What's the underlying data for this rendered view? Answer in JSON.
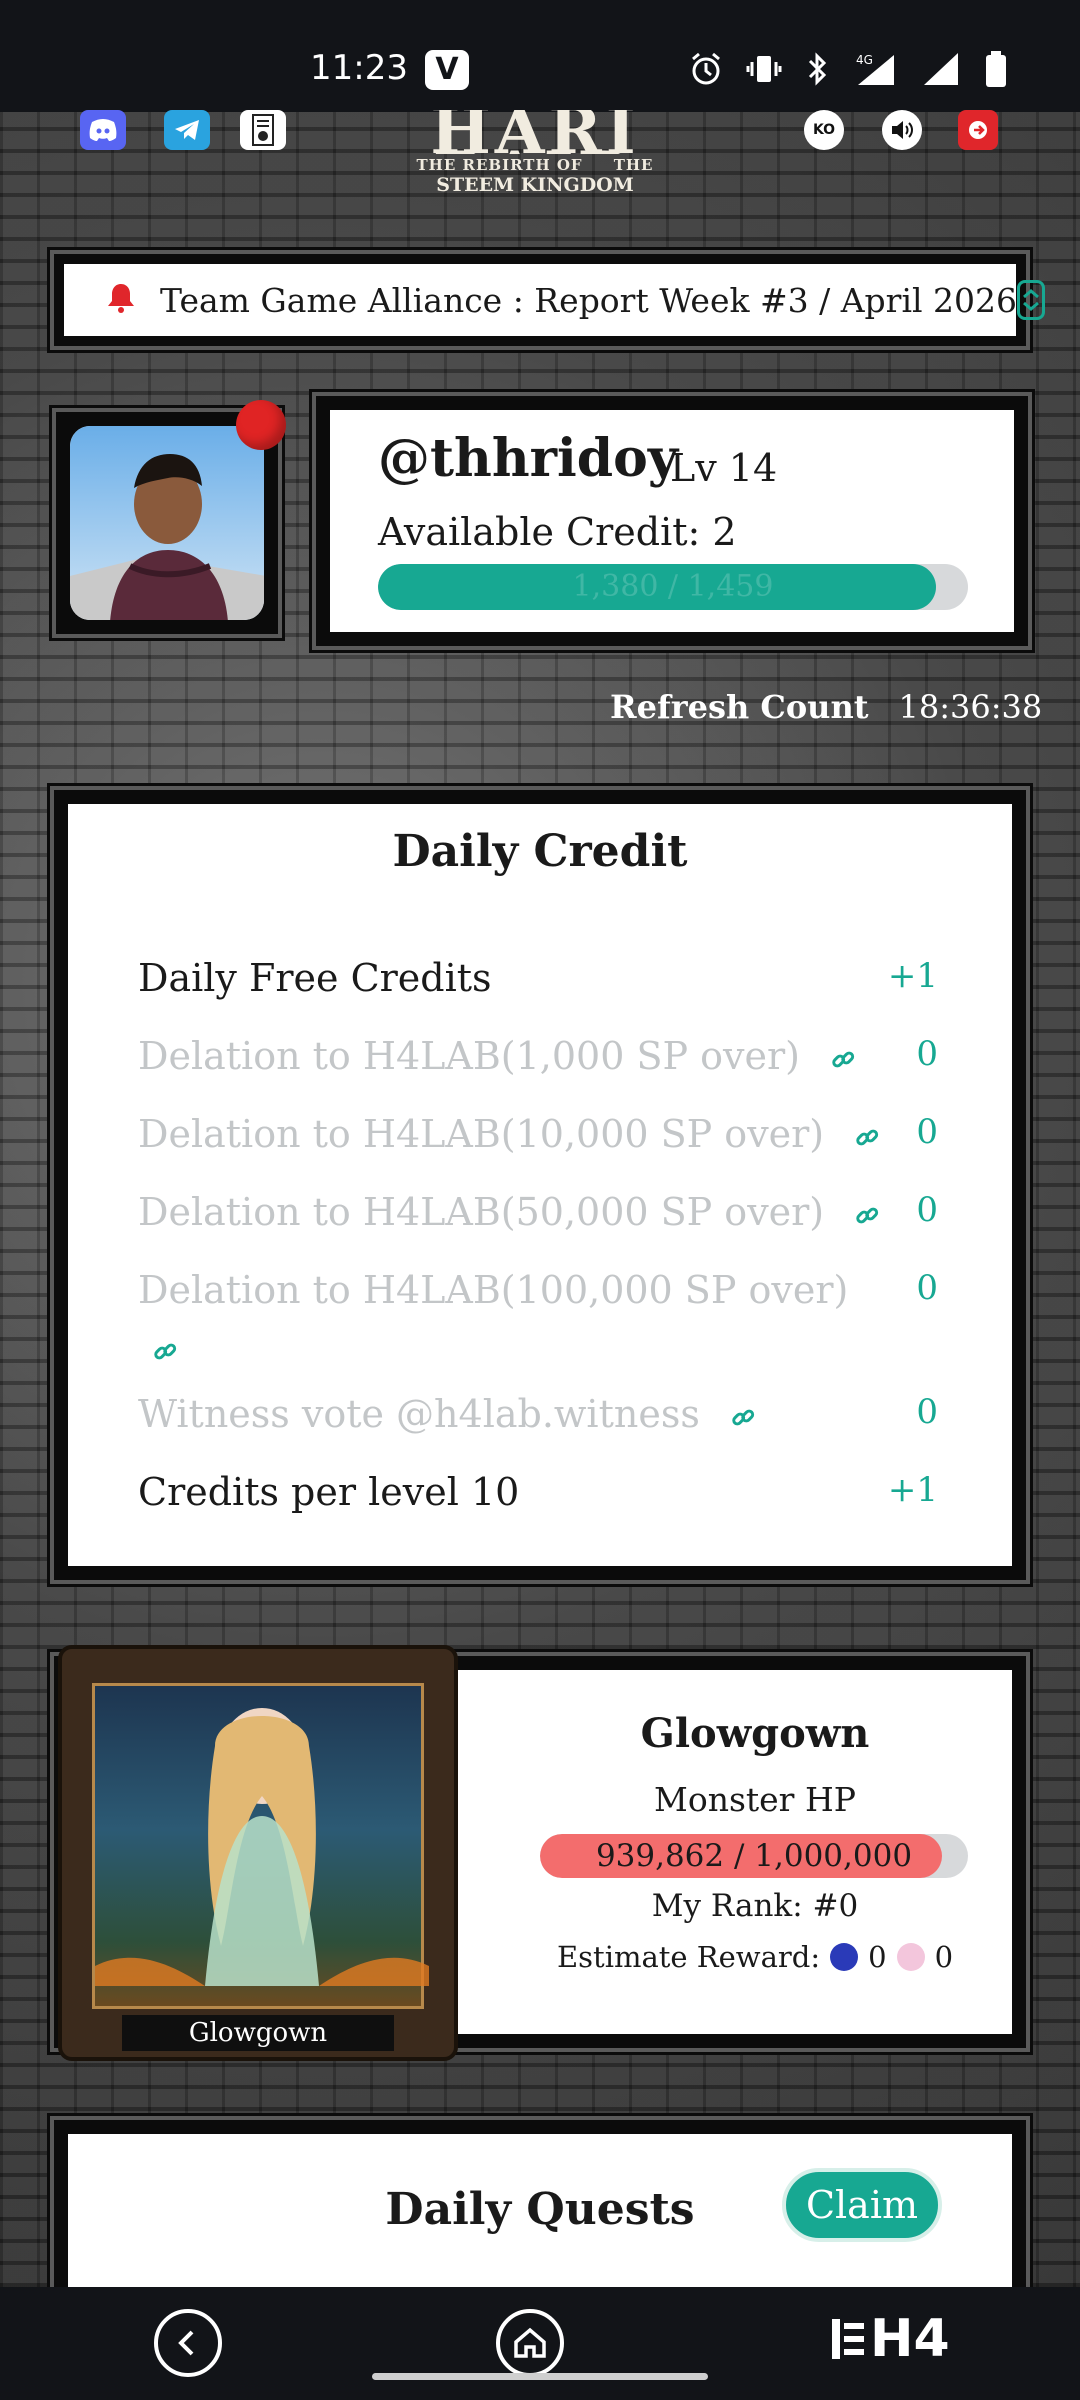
{
  "status_bar": {
    "time": "11:23",
    "app_badge": "V",
    "network": "4G"
  },
  "header": {
    "logo_main": "HARI RAID",
    "logo_sub_left": "THE REBIRTH OF",
    "logo_sub_right": "THE",
    "logo_sub_bottom": "STEEM KINGDOM",
    "ko_label": "KO",
    "icons": [
      "discord-icon",
      "telegram-icon",
      "bug-report-icon",
      "sound-icon",
      "logout-icon"
    ]
  },
  "announcement": {
    "text": "Team Game Alliance : Report Week #3 / April 2026"
  },
  "profile": {
    "username": "@thhridoy",
    "level": "Lv 14",
    "available_credit": "Available Credit: 2",
    "xp_text": "1,380 / 1,459",
    "xp_fraction": 0.946
  },
  "refresh": {
    "label": "Refresh Count",
    "value": "18:36:38"
  },
  "daily_credit": {
    "title": "Daily Credit",
    "rows": [
      {
        "label": "Daily Free Credits",
        "value": "+1"
      },
      {
        "label": "Delation to H4LAB(1,000 SP over)",
        "value": "0"
      },
      {
        "label": "Delation to H4LAB(10,000 SP over)",
        "value": "0"
      },
      {
        "label": "Delation to H4LAB(50,000 SP over)",
        "value": "0"
      },
      {
        "label": "Delation to H4LAB(100,000 SP over)",
        "value": "0"
      },
      {
        "label": "Witness vote @h4lab.witness",
        "value": "0"
      },
      {
        "label": "Credits per level 10",
        "value": "+1"
      }
    ]
  },
  "monster": {
    "card_name": "Glowgown",
    "name": "Glowgown",
    "hp_label": "Monster HP",
    "hp_text": "939,862 / 1,000,000",
    "hp_fraction": 0.9399,
    "rank": "My Rank: #0",
    "reward_label": "Estimate Reward:",
    "reward_steem": "0",
    "reward_token": "0"
  },
  "quests": {
    "title": "Daily Quests",
    "claim_label": "Claim"
  },
  "nav": {
    "brand": "H4"
  },
  "colors": {
    "accent": "#17a892",
    "hp": "#f36d6d",
    "notify": "#e02424"
  }
}
